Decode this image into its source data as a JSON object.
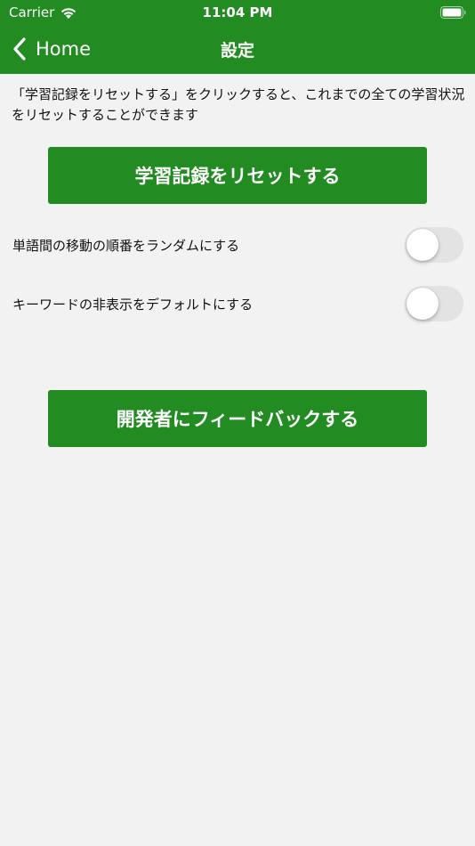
{
  "status_bar": {
    "carrier": "Carrier",
    "time": "11:04 PM",
    "wifi_icon": "wifi-icon",
    "battery_icon": "battery-icon"
  },
  "nav": {
    "back_label": "Home",
    "back_icon": "chevron-left-icon",
    "title": "設定"
  },
  "main": {
    "description": "「学習記録をリセットする」をクリックすると、これまでの全ての学習状況をリセットすることができます",
    "reset_button_label": "学習記録をリセットする",
    "settings": [
      {
        "label": "単語間の移動の順番をランダムにする",
        "enabled": false
      },
      {
        "label": "キーワードの非表示をデフォルトにする",
        "enabled": false
      }
    ],
    "feedback_button_label": "開発者にフィードバックする"
  },
  "colors": {
    "accent": "#228b22",
    "background": "#f2f2f2",
    "toggle_off": "#e3e3e3"
  }
}
